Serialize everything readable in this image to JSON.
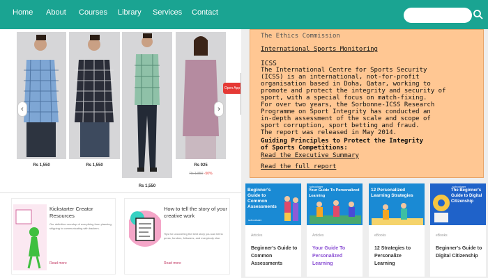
{
  "nav": {
    "items": [
      "Home",
      "About",
      "Courses",
      "Library",
      "Services",
      "Contact"
    ]
  },
  "icons": {
    "search": "search-icon",
    "prev": "chevron-left-icon",
    "next": "chevron-right-icon"
  },
  "colors": {
    "nav_bg": "#1aa492",
    "peach": "#ffc793",
    "course_blue": "#1a8ad4",
    "open_app": "#e53935"
  },
  "products": [
    {
      "price": "Rs 1,550"
    },
    {
      "price": "Rs 1,550"
    },
    {
      "price": "Rs 1,550"
    },
    {
      "price": "Rs 925",
      "old_price": "Rs 1,850",
      "discount": "-50%"
    }
  ],
  "open_app_label": "Open App",
  "blogs": [
    {
      "title": "Kickstarter Creator Resources",
      "desc": "Our definitive roundup of everything from planning, shipping to communicating with backers.",
      "read_more": "Read more"
    },
    {
      "title": "How to tell the story of your creative work",
      "desc": "Tips for uncovering the best story you can tell to press, funders, followers, and everybody else.",
      "read_more": "Read more"
    }
  ],
  "ethics_box": {
    "top_partial": "The Ethics Commission",
    "link1": "International Sports Monitoring",
    "heading": "ICSS",
    "para": [
      "The International Centre for Sports Security",
      "(ICSS) is an international, not-for-profit",
      "organisation based in Doha, Qatar, working to",
      "promote and protect the integrity and security of",
      "sport, with a special focus on match-fixing.",
      "For over two years, the Sorbonne-ICSS Research",
      "Programme on Sport Integrity has conducted an",
      "in-depth assessment of the scale and scope of",
      "sport corruption, sport betting and fraud.",
      "The report was released in May 2014."
    ],
    "bold": [
      "Guiding Principles to Protect the Integrity",
      "of Sports Competitions:"
    ],
    "link_exec": "Read the Executive Summary",
    "link_full": "Read the full report"
  },
  "courses": [
    {
      "thumb_title": "Beginner's Guide to Common Assessments",
      "brand": "schoolsaer",
      "tag": "Articles",
      "title": "Beginner's Guide to Common Assessments"
    },
    {
      "thumb_title": "Your Guide To Personalized Learning",
      "brand": "schoolsaer",
      "tag": "Articles",
      "title": "Your Guide To Personalized Learning"
    },
    {
      "thumb_title": "12 Personalized Learning Strategies",
      "brand": "",
      "tag": "eBooks",
      "title": "12 Strategies to Personalize Learning"
    },
    {
      "thumb_title": "The Beginner's Guide to Digital Citizenship",
      "brand": "schoolsaer",
      "tag": "eBooks",
      "title": "Beginner's Guide to Digital Citizenship"
    }
  ]
}
